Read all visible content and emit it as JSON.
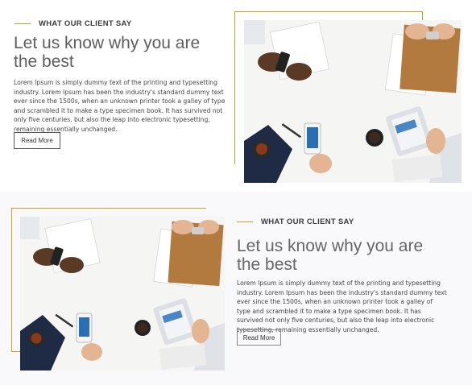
{
  "sections": [
    {
      "eyebrow": "WHAT OUR CLIENT SAY",
      "headline_line1": "Let us know why you are",
      "headline_line2": "the best",
      "body": "Lorem Ipsum is simply dummy text of the printing and typesetting industry. Lorem Ipsum has been the industry's standard dummy text ever since the 1500s, when an unknown printer took a galley of type and scrambled it to make a type specimen book. It has survived not only five centuries, but also the leap into electronic typesetting, remaining essentially unchanged.",
      "button_label": "Read More"
    },
    {
      "eyebrow": "WHAT OUR CLIENT SAY",
      "headline_line1": "Let us know why you are",
      "headline_line2": "the best",
      "body": "Lorem Ipsum is simply dummy text of the printing and typesetting industry. Lorem Ipsum has been the industry's standard dummy text ever since the 1500s, when an unknown printer took a galley of type and scrambled it to make a type specimen book. It has survived not only five centuries, but also the leap into electronic typesetting, remaining essentially unchanged.",
      "button_label": "Read More"
    }
  ],
  "colors": {
    "accent": "#c9a227",
    "heading": "#5e5e5e",
    "text": "#444444",
    "section_alt_bg": "#f9f9fb"
  }
}
